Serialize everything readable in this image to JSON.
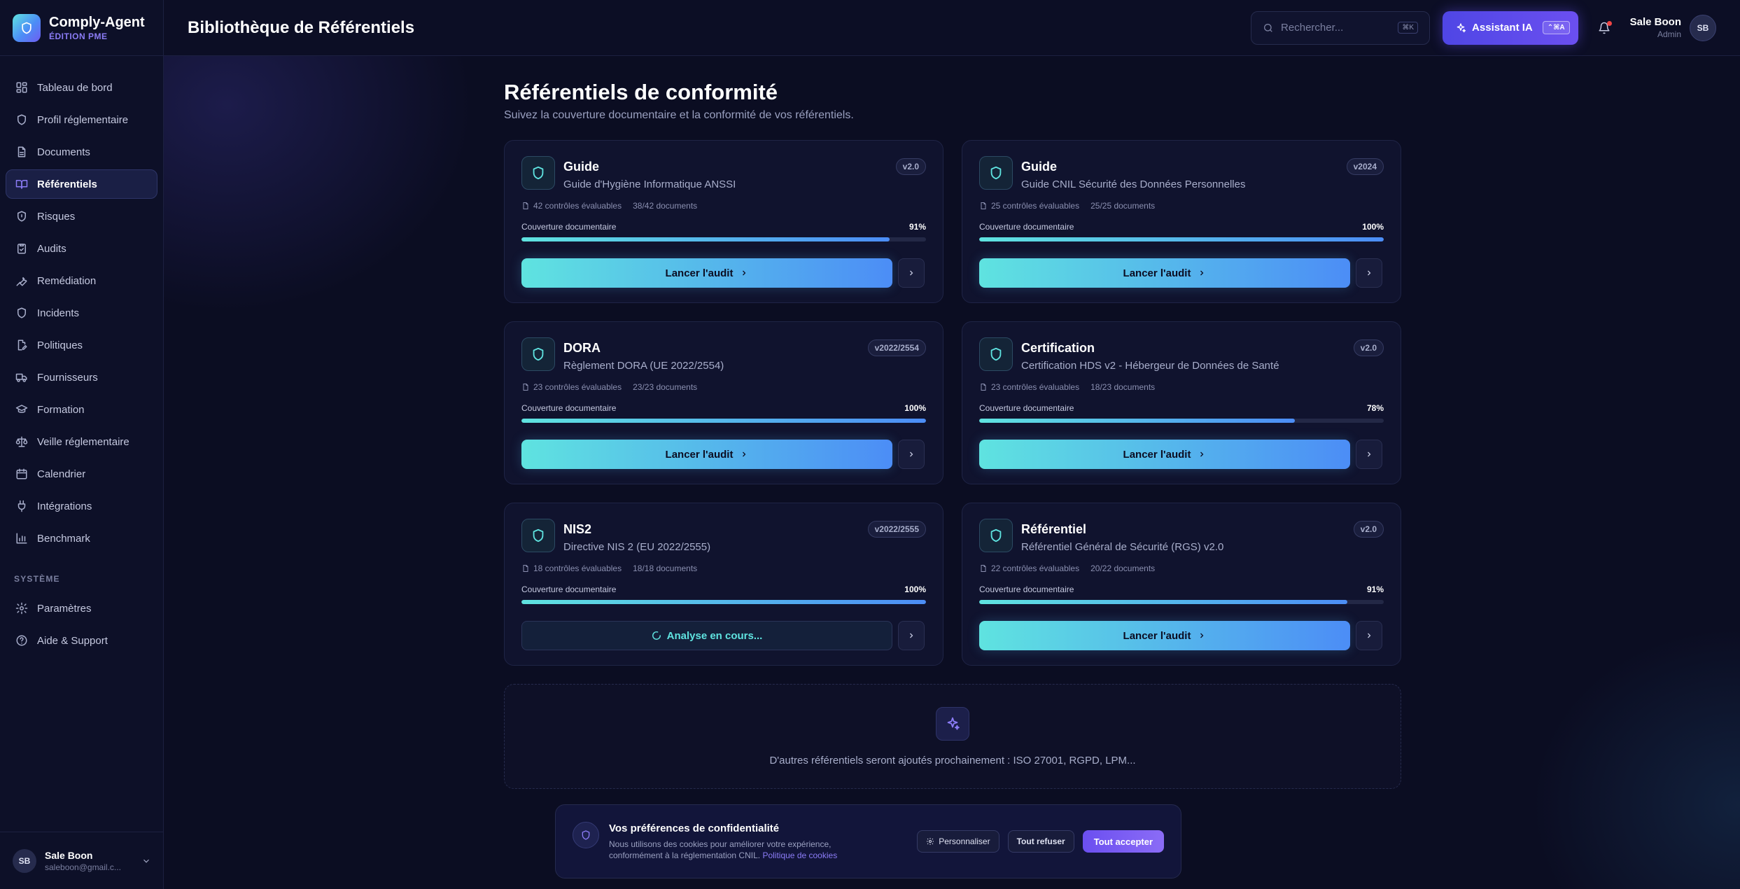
{
  "brand": {
    "name": "Comply-Agent",
    "edition": "ÉDITION PME"
  },
  "header": {
    "title": "Bibliothèque de Référentiels",
    "search_placeholder": "Rechercher...",
    "search_kbd": "⌘K",
    "ai_label": "Assistant IA",
    "ai_kbd": "⌃⌘A",
    "user_name": "Sale Boon",
    "user_role": "Admin",
    "user_initials": "SB"
  },
  "sidebar": {
    "items": [
      {
        "label": "Tableau de bord",
        "icon": "dashboard-icon"
      },
      {
        "label": "Profil réglementaire",
        "icon": "shield-icon"
      },
      {
        "label": "Documents",
        "icon": "document-icon"
      },
      {
        "label": "Référentiels",
        "icon": "book-icon",
        "active": true
      },
      {
        "label": "Risques",
        "icon": "shield-alert-icon"
      },
      {
        "label": "Audits",
        "icon": "clipboard-check-icon"
      },
      {
        "label": "Remédiation",
        "icon": "wrench-icon"
      },
      {
        "label": "Incidents",
        "icon": "shield-icon"
      },
      {
        "label": "Politiques",
        "icon": "file-edit-icon"
      },
      {
        "label": "Fournisseurs",
        "icon": "truck-icon"
      },
      {
        "label": "Formation",
        "icon": "graduation-cap-icon"
      },
      {
        "label": "Veille réglementaire",
        "icon": "scale-icon"
      },
      {
        "label": "Calendrier",
        "icon": "calendar-icon"
      },
      {
        "label": "Intégrations",
        "icon": "plug-icon"
      },
      {
        "label": "Benchmark",
        "icon": "bar-chart-icon"
      }
    ],
    "section_label": "SYSTÈME",
    "system_items": [
      {
        "label": "Paramètres",
        "icon": "gear-icon"
      },
      {
        "label": "Aide & Support",
        "icon": "help-circle-icon"
      }
    ],
    "user": {
      "initials": "SB",
      "name": "Sale Boon",
      "email": "saleboon@gmail.c..."
    }
  },
  "main": {
    "heading": "Référentiels de conformité",
    "subheading": "Suivez la couverture documentaire et la conformité de vos référentiels.",
    "coverage_label": "Couverture documentaire",
    "audit_label": "Lancer l'audit",
    "analysing_label": "Analyse en cours...",
    "cards": [
      {
        "title": "Guide",
        "desc": "Guide d'Hygiène Informatique ANSSI",
        "version": "v2.0",
        "controls": "42 contrôles évaluables",
        "docs": "38/42 documents",
        "coverage": 91,
        "coverage_text": "91%",
        "status": "ready"
      },
      {
        "title": "Guide",
        "desc": "Guide CNIL Sécurité des Données Personnelles",
        "version": "v2024",
        "controls": "25 contrôles évaluables",
        "docs": "25/25 documents",
        "coverage": 100,
        "coverage_text": "100%",
        "status": "ready"
      },
      {
        "title": "DORA",
        "desc": "Règlement DORA (UE 2022/2554)",
        "version": "v2022/2554",
        "controls": "23 contrôles évaluables",
        "docs": "23/23 documents",
        "coverage": 100,
        "coverage_text": "100%",
        "status": "ready"
      },
      {
        "title": "Certification",
        "desc": "Certification HDS v2 - Hébergeur de Données de Santé",
        "version": "v2.0",
        "controls": "23 contrôles évaluables",
        "docs": "18/23 documents",
        "coverage": 78,
        "coverage_text": "78%",
        "status": "ready"
      },
      {
        "title": "NIS2",
        "desc": "Directive NIS 2 (EU 2022/2555)",
        "version": "v2022/2555",
        "controls": "18 contrôles évaluables",
        "docs": "18/18 documents",
        "coverage": 100,
        "coverage_text": "100%",
        "status": "analysing"
      },
      {
        "title": "Référentiel",
        "desc": "Référentiel Général de Sécurité (RGS) v2.0",
        "version": "v2.0",
        "controls": "22 contrôles évaluables",
        "docs": "20/22 documents",
        "coverage": 91,
        "coverage_text": "91%",
        "status": "ready"
      }
    ],
    "upcoming_text": "D'autres référentiels seront ajoutés prochainement : ISO 27001, RGPD, LPM..."
  },
  "cookie": {
    "title": "Vos préférences de confidentialité",
    "text": "Nous utilisons des cookies pour améliorer votre expérience, conformément à la réglementation CNIL.",
    "link": "Politique de cookies",
    "customize": "Personnaliser",
    "reject": "Tout refuser",
    "accept": "Tout accepter"
  },
  "colors": {
    "accent": "#6b4ff0",
    "teal": "#5fe3e0",
    "blue": "#4c8df6",
    "bg": "#0b0d22"
  }
}
